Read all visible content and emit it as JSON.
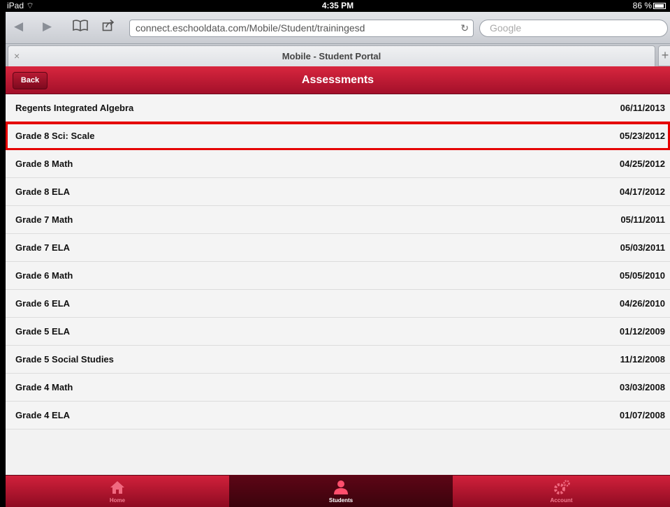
{
  "status": {
    "device": "iPad",
    "time": "4:35 PM",
    "battery": "86 %"
  },
  "browser": {
    "url": "connect.eschooldata.com/Mobile/Student/trainingesd",
    "search_placeholder": "Google",
    "tab_title": "Mobile - Student Portal",
    "tab_close": "×",
    "new_tab": "+"
  },
  "header": {
    "back_label": "Back",
    "title": "Assessments"
  },
  "assessments": [
    {
      "name": "Regents Integrated Algebra",
      "date": "06/11/2013"
    },
    {
      "name": "Grade 8 Sci: Scale",
      "date": "05/23/2012"
    },
    {
      "name": "Grade 8 Math",
      "date": "04/25/2012"
    },
    {
      "name": "Grade 8 ELA",
      "date": "04/17/2012"
    },
    {
      "name": "Grade 7 Math",
      "date": "05/11/2011"
    },
    {
      "name": "Grade 7 ELA",
      "date": "05/03/2011"
    },
    {
      "name": "Grade 6 Math",
      "date": "05/05/2010"
    },
    {
      "name": "Grade 6 ELA",
      "date": "04/26/2010"
    },
    {
      "name": "Grade 5 ELA",
      "date": "01/12/2009"
    },
    {
      "name": "Grade 5 Social Studies",
      "date": "11/12/2008"
    },
    {
      "name": "Grade 4 Math",
      "date": "03/03/2008"
    },
    {
      "name": "Grade 4 ELA",
      "date": "01/07/2008"
    }
  ],
  "highlighted_item": "Grade 8 Sci: Scale",
  "bottom_nav": {
    "home": "Home",
    "students": "Students",
    "account": "Account",
    "active": "Students"
  },
  "colors": {
    "brand_red": "#c4162f",
    "highlight": "#e50000"
  }
}
